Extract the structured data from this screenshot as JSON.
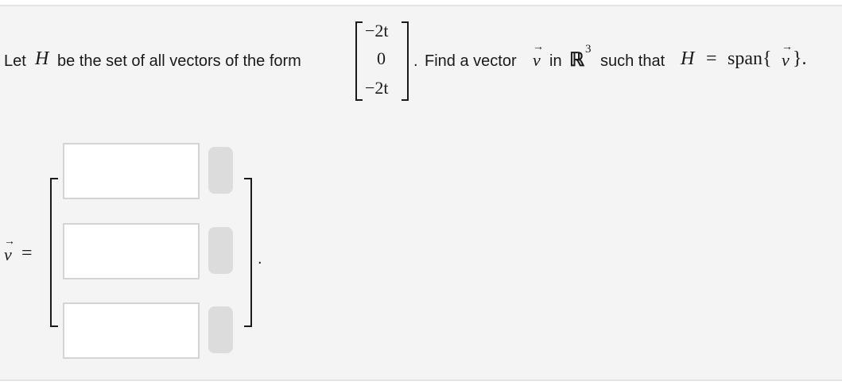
{
  "question": {
    "intro_before_H": "Let",
    "H_symbol": "H",
    "intro_after_H": "be the set of all vectors of the form",
    "form_vector": [
      "−2t",
      "0",
      "−2t"
    ],
    "period": ".",
    "find_text": "Find a vector",
    "v_symbol": "v",
    "in_text": "in",
    "R_symbol": "ℝ",
    "R_exponent": "3",
    "such_that": "such that",
    "H_again": "H",
    "equals": "=",
    "span_text": "span{",
    "span_close": "}."
  },
  "answer": {
    "v_label": "v",
    "equals": "=",
    "inputs": [
      {
        "value": ""
      },
      {
        "value": ""
      },
      {
        "value": ""
      }
    ],
    "trailing_period": "."
  }
}
